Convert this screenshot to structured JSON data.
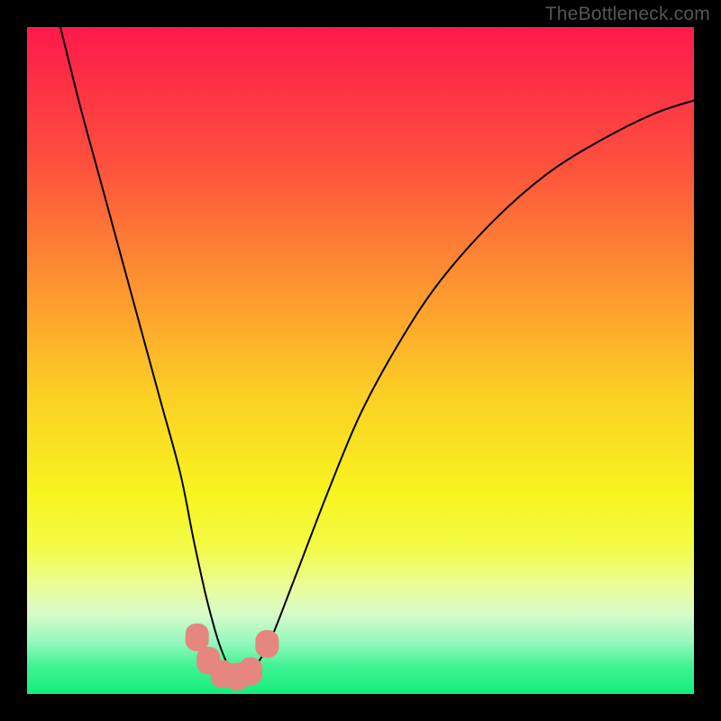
{
  "watermark": "TheBottleneck.com",
  "chart_data": {
    "type": "line",
    "title": "",
    "xlabel": "",
    "ylabel": "",
    "xlim": [
      0,
      100
    ],
    "ylim": [
      0,
      100
    ],
    "background_gradient": {
      "stops": [
        {
          "offset": 0,
          "color": "#fd1a4b"
        },
        {
          "offset": 20,
          "color": "#fd4f3e"
        },
        {
          "offset": 40,
          "color": "#fd9930"
        },
        {
          "offset": 55,
          "color": "#fccf25"
        },
        {
          "offset": 70,
          "color": "#f7f41f"
        },
        {
          "offset": 78,
          "color": "#f3fb47"
        },
        {
          "offset": 84,
          "color": "#eafd9a"
        },
        {
          "offset": 88,
          "color": "#d7fcc7"
        },
        {
          "offset": 92,
          "color": "#99f8c0"
        },
        {
          "offset": 96,
          "color": "#3ef291"
        },
        {
          "offset": 100,
          "color": "#14ee7d"
        }
      ]
    },
    "series": [
      {
        "name": "bottleneck-curve",
        "x": [
          5,
          8,
          11,
          14,
          17,
          20,
          23,
          25,
          27,
          29,
          31,
          33,
          36,
          40,
          45,
          50,
          56,
          62,
          70,
          78,
          86,
          94,
          100
        ],
        "y": [
          100,
          88,
          77,
          66,
          55,
          44,
          33,
          23,
          14,
          7,
          3,
          3,
          7,
          17,
          30,
          42,
          53,
          62,
          71,
          78,
          83,
          87,
          89
        ],
        "stroke": "#000000",
        "stroke_width": 2
      }
    ],
    "markers": [
      {
        "x": 25.5,
        "y": 8.5,
        "r": 1.6,
        "color": "#e5877e"
      },
      {
        "x": 27.2,
        "y": 5.0,
        "r": 1.6,
        "color": "#e5877e"
      },
      {
        "x": 29.3,
        "y": 3.0,
        "r": 1.6,
        "color": "#e5877e"
      },
      {
        "x": 31.5,
        "y": 2.6,
        "r": 1.6,
        "color": "#e5877e"
      },
      {
        "x": 33.5,
        "y": 3.4,
        "r": 1.6,
        "color": "#e5877e"
      },
      {
        "x": 36.0,
        "y": 7.5,
        "r": 1.6,
        "color": "#e5877e"
      }
    ]
  }
}
